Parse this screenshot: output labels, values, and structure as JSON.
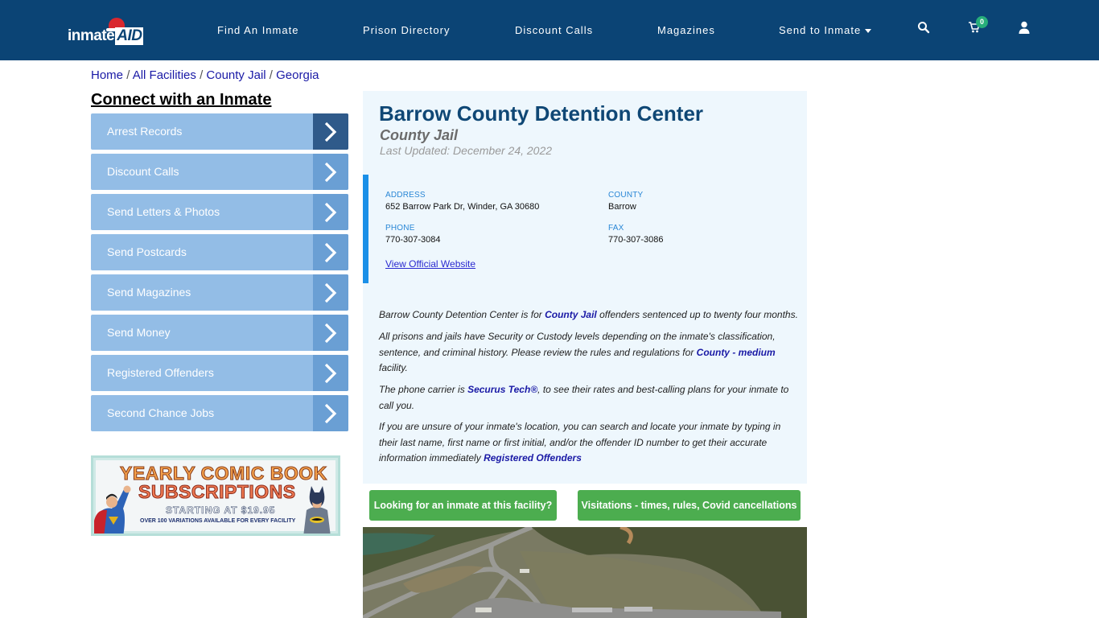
{
  "header": {
    "logo_text": "inmate",
    "logo_aid": "AID",
    "nav": [
      {
        "label": "Find An Inmate"
      },
      {
        "label": "Prison Directory"
      },
      {
        "label": "Discount Calls"
      },
      {
        "label": "Magazines"
      },
      {
        "label": "Send to Inmate",
        "has_dropdown": true
      }
    ],
    "cart_count": "0",
    "icons": [
      "search-icon",
      "cart-icon",
      "user-icon"
    ],
    "bg_color": "#0b4475"
  },
  "breadcrumb": [
    {
      "label": "Home"
    },
    {
      "label": "All Facilities"
    },
    {
      "label": "County Jail"
    },
    {
      "label": "Georgia"
    }
  ],
  "breadcrumb_sep": "/",
  "sidebar": {
    "title": "Connect with an Inmate",
    "items": [
      {
        "label": "Arrest Records",
        "active": true
      },
      {
        "label": "Discount Calls"
      },
      {
        "label": "Send Letters & Photos"
      },
      {
        "label": "Send Postcards"
      },
      {
        "label": "Send Magazines"
      },
      {
        "label": "Send Money"
      },
      {
        "label": "Registered Offenders"
      },
      {
        "label": "Second Chance Jobs"
      }
    ],
    "ad": {
      "line1": "YEARLY COMIC BOOK",
      "line2": "SUBSCRIPTIONS",
      "line3": "STARTING AT $19.95",
      "line4": "OVER 100 VARIATIONS AVAILABLE FOR EVERY FACILITY"
    }
  },
  "facility": {
    "name": "Barrow County Detention Center",
    "type": "County Jail",
    "last_updated": "Last Updated: December 24, 2022",
    "address_label": "ADDRESS",
    "address": "652 Barrow Park Dr, Winder, GA 30680",
    "county_label": "COUNTY",
    "county": "Barrow",
    "phone_label": "PHONE",
    "phone": "770-307-3084",
    "fax_label": "FAX",
    "fax": "770-307-3086",
    "website_link": "View Official Website"
  },
  "description": {
    "p1_a": "Barrow County Detention Center is for ",
    "p1_link": "County Jail",
    "p1_b": " offenders sentenced up to twenty four months.",
    "p2_a": "All prisons and jails have Security or Custody levels depending on the inmate's classification, sentence, and criminal history. Please review the rules and regulations for ",
    "p2_link": "County - medium",
    "p2_b": " facility.",
    "p3_a": "The phone carrier is ",
    "p3_link": "Securus Tech®",
    "p3_b": ", to see their rates and best-calling plans for your inmate to call you.",
    "p4_a": "If you are unsure of your inmate's location, you can search and locate your inmate by typing in their last name, first name or first initial, and/or the offender ID number to get their accurate information immediately ",
    "p4_link": "Registered Offenders"
  },
  "actions": {
    "find_inmate": "Looking for an inmate at this facility?",
    "visitations": "Visitations - times, rules, Covid cancellations"
  },
  "colors": {
    "accent_green": "#4cad4f",
    "sidebar_item": "#93bde6",
    "title_blue": "#0f4775",
    "info_border": "#1b90e8"
  }
}
